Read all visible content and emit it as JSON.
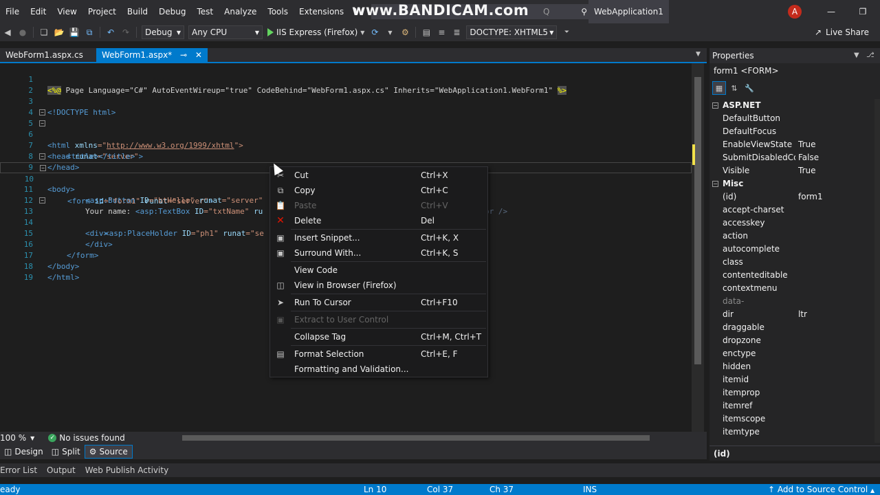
{
  "menubar": {
    "items": [
      "File",
      "Edit",
      "View",
      "Project",
      "Build",
      "Debug",
      "Test",
      "Analyze",
      "Tools",
      "Extensions",
      "W"
    ],
    "search_placeholder": "Q",
    "watermark": "www.BANDICAM.com",
    "solution_name": "WebApplication1",
    "avatar_initial": "A"
  },
  "toolbar": {
    "config": "Debug",
    "platform": "Any CPU",
    "run_label": "IIS Express (Firefox)",
    "doctype": "DOCTYPE: XHTML5",
    "live_share": "Live Share"
  },
  "doc_tabs": {
    "tab1": "WebForm1.aspx.cs",
    "tab2": "WebForm1.aspx*",
    "pin": "⊸",
    "close": "✕"
  },
  "editor": {
    "line_numbers": [
      "1",
      "2",
      "3",
      "4",
      "5",
      "6",
      "7",
      "8",
      "9",
      "10",
      "11",
      "12",
      "13",
      "14",
      "15",
      "16",
      "17",
      "18",
      "19"
    ],
    "l1": {
      "open": "<%@",
      "rest": " Page Language=\"C#\" AutoEventWireup=\"true\" CodeBehind=\"WebForm1.aspx.cs\" Inherits=\"WebApplication1.WebForm1\" ",
      "close": "%>"
    },
    "l3": "<!DOCTYPE html>",
    "l5": {
      "tag": "<html ",
      "attr": "xmlns",
      "eq": "=\"",
      "url": "http://www.w3.org/1999/xhtml",
      "end": "\">"
    },
    "l6": {
      "tag": "<head ",
      "attr": "runat",
      "val": "=\"server\"",
      "end": ">"
    },
    "l7": {
      "open": "<title></title>"
    },
    "l8": "</head>",
    "l9": "<body>",
    "l10": {
      "tag": "<form ",
      "attr1": "id",
      "val1": "=\"form1\" ",
      "attr2": "runat",
      "val2": "=\"server\"",
      "end": ">"
    },
    "l11": {
      "tag": "<asp:Button ",
      "attr1": "ID",
      "val1": "=\"btHello\" ",
      "attr2": "runat",
      "val2": "=\"server\" ",
      "tail": "or />"
    },
    "l12": {
      "text": "Your name: ",
      "tag": "<asp:TextBox ",
      "attr1": "ID",
      "val1": "=\"txtName\" ",
      "attr2": "ru"
    },
    "l13": "<div>",
    "l14": {
      "tag": "<asp:PlaceHolder ",
      "attr1": "ID",
      "val1": "=\"ph1\" ",
      "attr2": "runat",
      "val2": "=\"se"
    },
    "l15": "</div>",
    "l16": "</form>",
    "l17": "</body>",
    "l18": "</html>"
  },
  "bottom": {
    "zoom": "100 %",
    "issues": "No issues found",
    "view_design": "Design",
    "view_split": "Split",
    "view_source": "Source",
    "tool_tabs": [
      "Error List",
      "Output",
      "Web Publish Activity"
    ]
  },
  "status": {
    "ready": "eady",
    "ln": "Ln 10",
    "col": "Col 37",
    "ch": "Ch 37",
    "ins": "INS",
    "source_control": "Add to Source Control"
  },
  "properties": {
    "title": "Properties",
    "object": "form1 <FORM>",
    "categories": [
      "ASP.NET",
      "Misc"
    ],
    "aspnet": [
      {
        "name": "DefaultButton",
        "value": ""
      },
      {
        "name": "DefaultFocus",
        "value": ""
      },
      {
        "name": "EnableViewState",
        "value": "True"
      },
      {
        "name": "SubmitDisabledControls",
        "value": "False"
      },
      {
        "name": "Visible",
        "value": "True"
      }
    ],
    "misc": [
      {
        "name": "(id)",
        "value": "form1"
      },
      {
        "name": "accept-charset",
        "value": ""
      },
      {
        "name": "accesskey",
        "value": ""
      },
      {
        "name": "action",
        "value": ""
      },
      {
        "name": "autocomplete",
        "value": ""
      },
      {
        "name": "class",
        "value": ""
      },
      {
        "name": "contenteditable",
        "value": ""
      },
      {
        "name": "contextmenu",
        "value": ""
      },
      {
        "name": "data-",
        "value": ""
      },
      {
        "name": "dir",
        "value": "ltr"
      },
      {
        "name": "draggable",
        "value": ""
      },
      {
        "name": "dropzone",
        "value": ""
      },
      {
        "name": "enctype",
        "value": ""
      },
      {
        "name": "hidden",
        "value": ""
      },
      {
        "name": "itemid",
        "value": ""
      },
      {
        "name": "itemprop",
        "value": ""
      },
      {
        "name": "itemref",
        "value": ""
      },
      {
        "name": "itemscope",
        "value": ""
      },
      {
        "name": "itemtype",
        "value": ""
      }
    ],
    "description_title": "(id)"
  },
  "context_menu": {
    "cut": {
      "label": "Cut",
      "key": "Ctrl+X"
    },
    "copy": {
      "label": "Copy",
      "key": "Ctrl+C"
    },
    "paste": {
      "label": "Paste",
      "key": "Ctrl+V"
    },
    "delete": {
      "label": "Delete",
      "key": "Del"
    },
    "insert_snippet": {
      "label": "Insert Snippet...",
      "key": "Ctrl+K, X"
    },
    "surround_with": {
      "label": "Surround With...",
      "key": "Ctrl+K, S"
    },
    "view_code": {
      "label": "View Code",
      "key": ""
    },
    "view_browser": {
      "label": "View in Browser (Firefox)",
      "key": ""
    },
    "run_to_cursor": {
      "label": "Run To Cursor",
      "key": "Ctrl+F10"
    },
    "extract_user_control": {
      "label": "Extract to User Control",
      "key": ""
    },
    "collapse_tag": {
      "label": "Collapse Tag",
      "key": "Ctrl+M, Ctrl+T"
    },
    "format_selection": {
      "label": "Format Selection",
      "key": "Ctrl+E, F"
    },
    "formatting_validation": {
      "label": "Formatting and Validation...",
      "key": ""
    }
  },
  "colors": {
    "accent": "#007acc",
    "background": "#1e1e1e",
    "chrome": "#2d2d30",
    "delete_icon": "#e51400",
    "run_icon": "#63d35f"
  }
}
